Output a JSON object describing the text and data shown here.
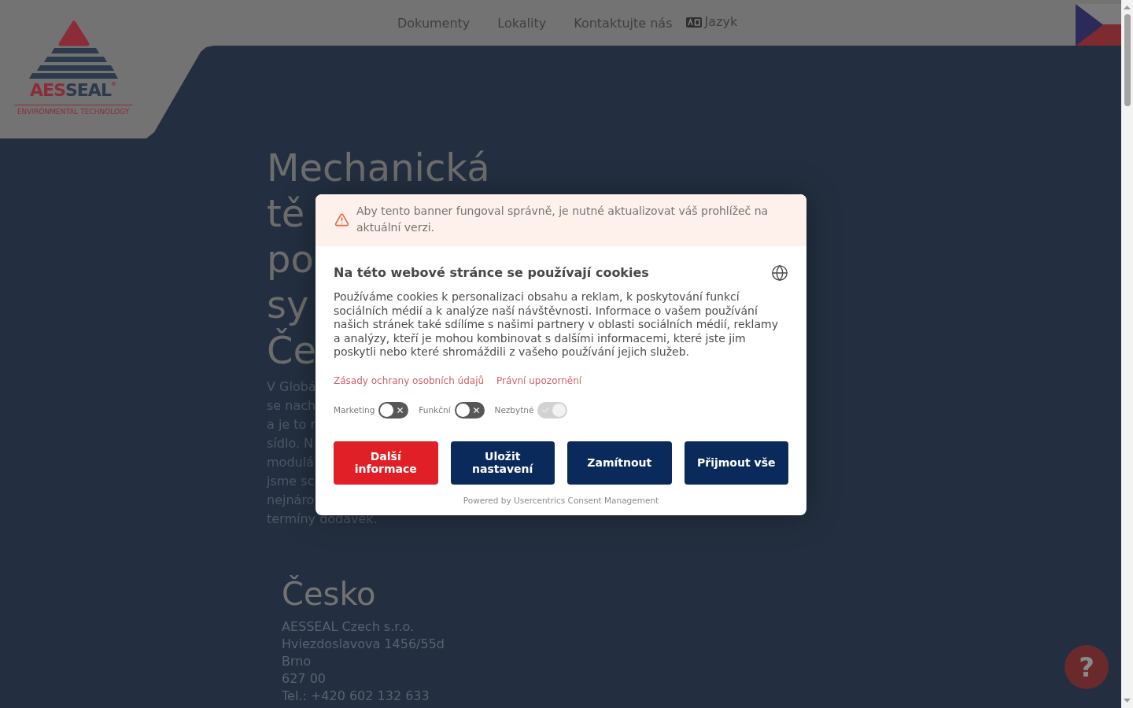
{
  "header": {
    "logo": {
      "wordmark": [
        "AES",
        "SEAL"
      ],
      "registered": "®",
      "tagline": "ENVIRONMENTAL TECHNOLOGY"
    },
    "nav": [
      "Dokumenty",
      "Lokality",
      "Kontaktujte nás"
    ],
    "language": {
      "label": "Jazyk"
    }
  },
  "hero": {
    "title_lines": [
      "Mechanická",
      "tě",
      "po",
      "sy",
      "Če"
    ],
    "text_lines": [
      "V Globá",
      "se nach",
      "a je to r",
      "sídlo. N",
      "modulá",
      "jsme sc",
      "nejnáro",
      "termíny dodávek."
    ]
  },
  "location": {
    "heading": "Česko",
    "lines": [
      "AESSEAL Czech s.r.o.",
      "Hviezdoslavova 1456/55d",
      "Brno",
      "627 00",
      "Tel.: +420 602 132 633"
    ]
  },
  "cookie_banner": {
    "warning": "Aby tento banner fungoval správně, je nutné aktualizovat váš prohlížeč na aktuální verzi.",
    "title": "Na této webové stránce se používají cookies",
    "body": "Používáme cookies k personalizaci obsahu a reklam, k poskytování funkcí sociálních médií a k analýze naší návštěvnosti. Informace o vašem používání našich stránek také sdílíme s našimi partnery v oblasti sociálních médií, reklamy a analýzy, kteří je mohou kombinovat s dalšími informacemi, které jste jim poskytli nebo které shromáždili z vašeho používání jejich služeb.",
    "links": [
      "Zásady ochrany osobních údajů",
      "Právní upozornění"
    ],
    "toggles": [
      {
        "label": "Marketing",
        "on": false,
        "disabled": false
      },
      {
        "label": "Funkční",
        "on": false,
        "disabled": false
      },
      {
        "label": "Nezbytné",
        "on": true,
        "disabled": true
      }
    ],
    "buttons": [
      {
        "label": "Další informace",
        "kind": "accent"
      },
      {
        "label": "Uložit nastavení",
        "kind": "default"
      },
      {
        "label": "Zamítnout",
        "kind": "default"
      },
      {
        "label": "Přijmout vše",
        "kind": "default"
      }
    ],
    "footer": "Powered by Usercentrics Consent Management"
  },
  "help_button": {
    "label": "?"
  }
}
